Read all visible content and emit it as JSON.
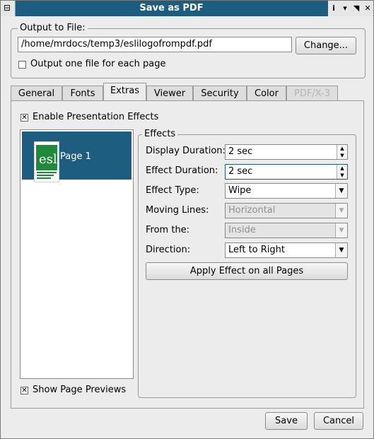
{
  "window": {
    "title": "Save as PDF",
    "menu_icon": "⊟",
    "buttons": [
      "i",
      "▾",
      "◥",
      "✕"
    ]
  },
  "output": {
    "group_label": "Output to File:",
    "path_value": "/home/mrdocs/temp3/eslilogofrompdf.pdf",
    "change_button": "Change...",
    "one_file_label": "Output one file for each page",
    "one_file_checked": false
  },
  "tabs": [
    {
      "label": "General",
      "active": false,
      "disabled": false
    },
    {
      "label": "Fonts",
      "active": false,
      "disabled": false
    },
    {
      "label": "Extras",
      "active": true,
      "disabled": false
    },
    {
      "label": "Viewer",
      "active": false,
      "disabled": false
    },
    {
      "label": "Security",
      "active": false,
      "disabled": false
    },
    {
      "label": "Color",
      "active": false,
      "disabled": false
    },
    {
      "label": "PDF/X-3",
      "active": false,
      "disabled": true
    }
  ],
  "extras": {
    "enable_effects_label": "Enable Presentation Effects",
    "enable_effects_checked": true,
    "pages": [
      {
        "label": "Page 1",
        "selected": true
      }
    ],
    "show_previews_label": "Show Page Previews",
    "show_previews_checked": true,
    "effects": {
      "group_label": "Effects",
      "display_duration_label": "Display Duration:",
      "display_duration_value": "2 sec",
      "effect_duration_label": "Effect Duration:",
      "effect_duration_value": "2 sec",
      "effect_type_label": "Effect Type:",
      "effect_type_value": "Wipe",
      "moving_lines_label": "Moving Lines:",
      "moving_lines_value": "Horizontal",
      "from_the_label": "From the:",
      "from_the_value": "Inside",
      "direction_label": "Direction:",
      "direction_value": "Left to Right",
      "apply_button": "Apply Effect on all Pages"
    }
  },
  "footer": {
    "save_button": "Save",
    "cancel_button": "Cancel"
  },
  "colors": {
    "titlebar": "#1d5e80",
    "selection": "#1d5e80",
    "logo_green": "#1e8a3a"
  }
}
